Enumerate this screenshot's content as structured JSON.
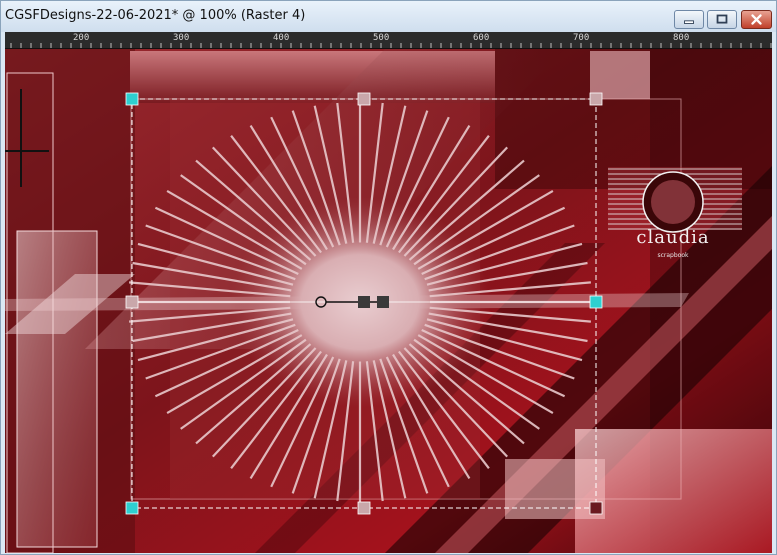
{
  "window": {
    "title": "CGSFDesigns-22-06-2021* @ 100% (Raster 4)"
  },
  "ruler": {
    "labels": [
      "200",
      "300",
      "400",
      "500",
      "600",
      "700",
      "800"
    ]
  },
  "canvas": {
    "logo_text": "claudia",
    "logo_subtext": "scrapbook",
    "accent_color": "#2ecfd0",
    "background_color": "#8b1a22"
  },
  "icons": {
    "minimize": "minimize-icon",
    "maximize": "maximize-icon",
    "close": "close-icon",
    "rotation_handle": "rotation-handle-icon"
  }
}
